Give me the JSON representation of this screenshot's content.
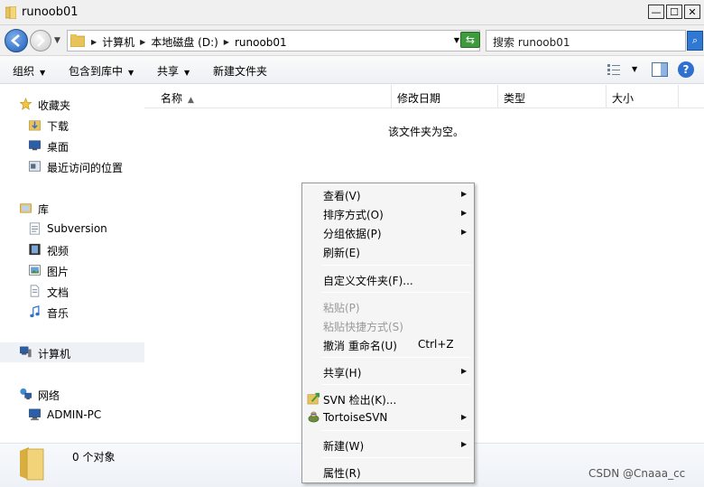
{
  "window": {
    "title": "runoob01",
    "minimize": "—",
    "maximize": "☐",
    "close": "✕"
  },
  "address": {
    "crumbs": [
      "计算机",
      "本地磁盘 (D:)",
      "runoob01"
    ],
    "search_placeholder": "搜索 runoob01"
  },
  "toolbar": {
    "organize": "组织",
    "include_library": "包含到库中",
    "share": "共享",
    "new_folder": "新建文件夹"
  },
  "sidebar": {
    "favorites": "收藏夹",
    "downloads": "下载",
    "desktop": "桌面",
    "recent": "最近访问的位置",
    "libraries": "库",
    "subversion": "Subversion",
    "videos": "视频",
    "pictures": "图片",
    "documents": "文档",
    "music": "音乐",
    "computer": "计算机",
    "network": "网络",
    "admin_pc": "ADMIN-PC"
  },
  "columns": {
    "name": "名称",
    "modified": "修改日期",
    "type": "类型",
    "size": "大小"
  },
  "content": {
    "empty_message": "该文件夹为空。"
  },
  "details": {
    "count": "0 个对象"
  },
  "watermark": "CSDN @Cnaaa_cc",
  "context_menu": {
    "view": "查看(V)",
    "sort_by": "排序方式(O)",
    "group_by": "分组依据(P)",
    "refresh": "刷新(E)",
    "customize": "自定义文件夹(F)...",
    "paste": "粘贴(P)",
    "paste_shortcut": "粘贴快捷方式(S)",
    "undo_rename": "撤消 重命名(U)",
    "undo_shortcut": "Ctrl+Z",
    "share": "共享(H)",
    "svn_checkout": "SVN 检出(K)...",
    "tortoisesvn": "TortoiseSVN",
    "new": "新建(W)",
    "properties": "属性(R)"
  },
  "colors": {
    "folder_yellow": "#e8c25a",
    "accent_blue": "#2f6fcf",
    "svn_green": "#3d9a3d"
  }
}
